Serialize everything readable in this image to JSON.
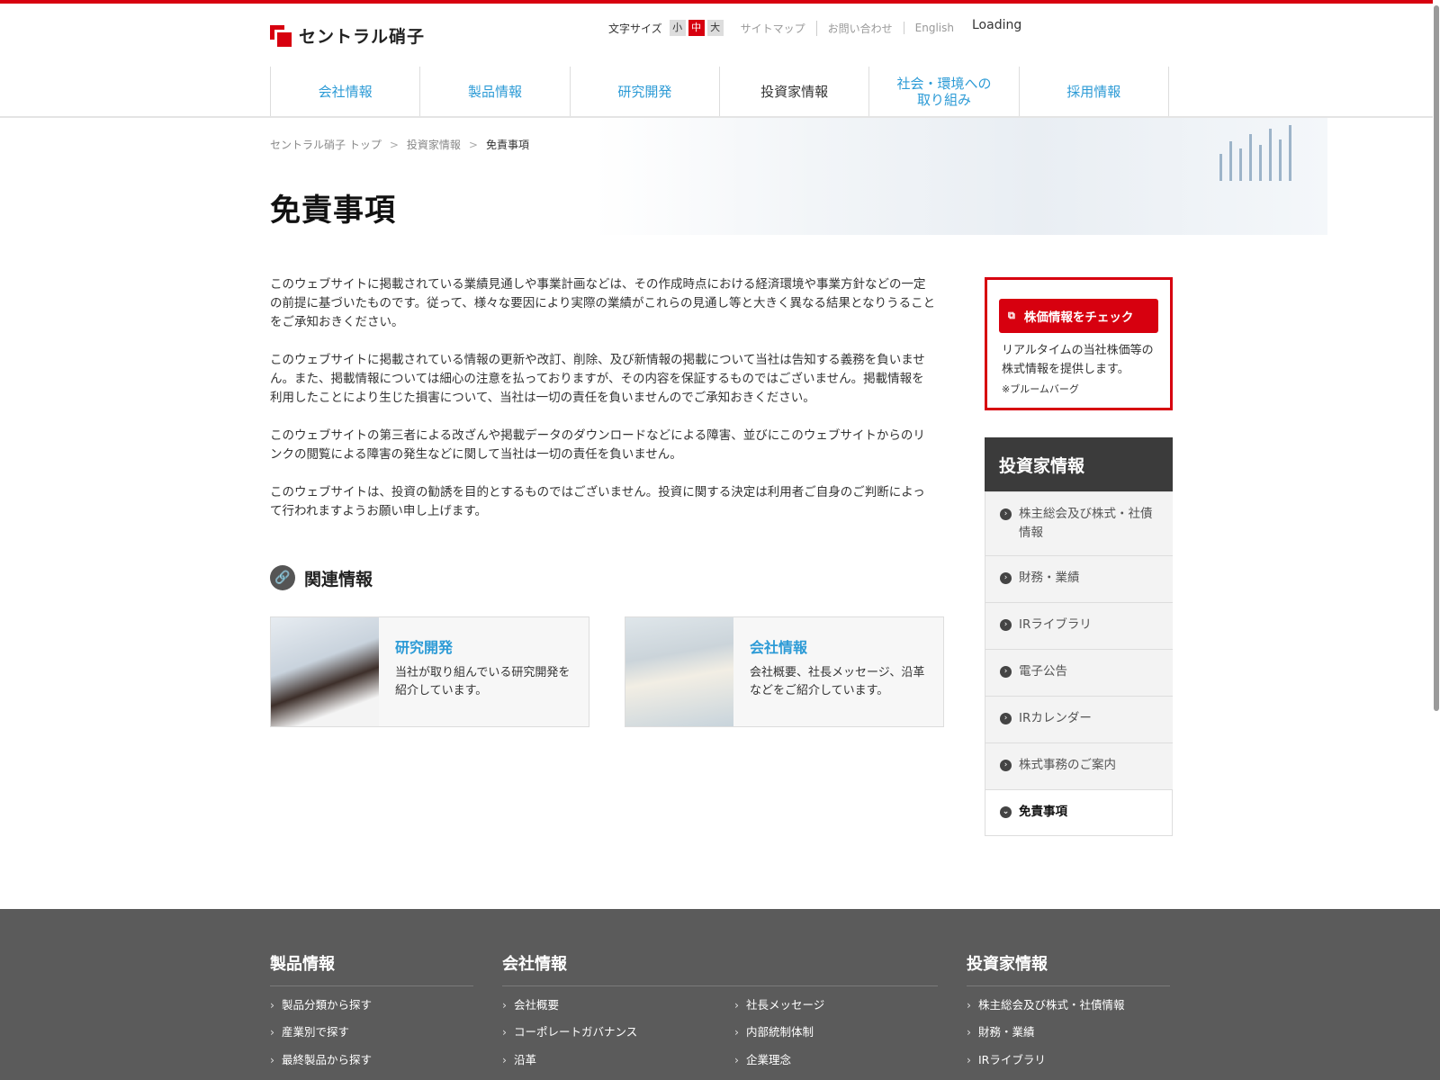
{
  "header": {
    "logo_text": "セントラル硝子",
    "font_size_label": "文字サイズ",
    "font_sizes": [
      "小",
      "中",
      "大"
    ],
    "util_links": [
      "サイトマップ",
      "お問い合わせ",
      "English"
    ],
    "loading": "Loading"
  },
  "nav": {
    "items": [
      {
        "label": "会社情報"
      },
      {
        "label": "製品情報"
      },
      {
        "label": "研究開発"
      },
      {
        "label": "投資家情報"
      },
      {
        "label": "社会・環境への 取り組み"
      },
      {
        "label": "採用情報"
      }
    ]
  },
  "breadcrumb": [
    "セントラル硝子 トップ",
    "投資家情報",
    "免責事項"
  ],
  "breadcrumb_sep": ">",
  "page_title": "免責事項",
  "main": {
    "paragraphs": [
      "このウェブサイトに掲載されている業績見通しや事業計画などは、その作成時点における経済環境や事業方針などの一定の前提に基づいたものです。従って、様々な要因により実際の業績がこれらの見通し等と大きく異なる結果となりうることをご承知おきください。",
      "このウェブサイトに掲載されている情報の更新や改訂、削除、及び新情報の掲載について当社は告知する義務を負いません。また、掲載情報については細心の注意を払っておりますが、その内容を保証するものではございません。掲載情報を利用したことにより生じた損害について、当社は一切の責任を負いませんのでご承知おきください。",
      "このウェブサイトの第三者による改ざんや掲載データのダウンロードなどによる障害、並びにこのウェブサイトからのリンクの閲覧による障害の発生などに関して当社は一切の責任を負いません。",
      "このウェブサイトは、投資の勧誘を目的とするものではございません。投資に関する決定は利用者ご自身のご判断によって行われますようお願い申し上げます。"
    ]
  },
  "related": {
    "title": "関連情報",
    "cards": [
      {
        "title": "研究開発",
        "desc": "当社が取り組んでいる研究開発を紹介しています。"
      },
      {
        "title": "会社情報",
        "desc": "会社概要、社長メッセージ、沿革などをご紹介しています。"
      }
    ]
  },
  "stock_box": {
    "button": "株価情報をチェック",
    "desc": "リアルタイムの当社株価等の株式情報を提供します。",
    "note": "※ブルームバーグ"
  },
  "side_nav": {
    "title": "投資家情報",
    "items": [
      {
        "label": "株主総会及び株式・社債情報"
      },
      {
        "label": "財務・業績"
      },
      {
        "label": "IRライブラリ"
      },
      {
        "label": "電子公告"
      },
      {
        "label": "IRカレンダー"
      },
      {
        "label": "株式事務のご案内"
      },
      {
        "label": "免責事項"
      }
    ]
  },
  "footer": {
    "columns": [
      {
        "title": "製品情報",
        "links": [
          "製品分類から探す",
          "産業別で探す",
          "最終製品から探す"
        ]
      },
      {
        "title": "会社情報",
        "links": [
          "会社概要",
          "コーポレートガバナンス",
          "沿革",
          "社長メッセージ",
          "内部統制体制",
          "企業理念"
        ]
      },
      {
        "title": "投資家情報",
        "links": [
          "株主総会及び株式・社債情報",
          "財務・業績",
          "IRライブラリ"
        ]
      }
    ]
  },
  "colors": {
    "brand_red": "#d7000f",
    "link_blue": "#2d9bd6",
    "footer_bg": "#5b5b5b",
    "side_head": "#3b3b3b"
  }
}
